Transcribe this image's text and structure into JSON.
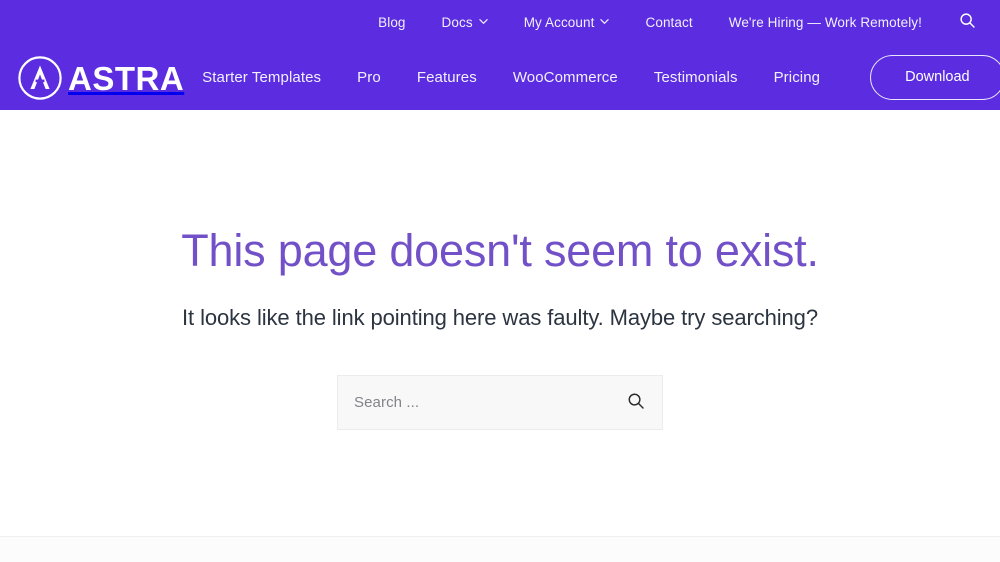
{
  "header": {
    "bg_color": "#5B2CE0",
    "brand": {
      "name": "ASTRA",
      "icon": "astra-logo-icon"
    },
    "top_nav": [
      {
        "label": "Blog",
        "has_dropdown": false
      },
      {
        "label": "Docs",
        "has_dropdown": true
      },
      {
        "label": "My Account",
        "has_dropdown": true
      },
      {
        "label": "Contact",
        "has_dropdown": false
      },
      {
        "label": "We're Hiring — Work Remotely!",
        "has_dropdown": false
      }
    ],
    "top_search_icon": "search-icon",
    "main_nav": [
      {
        "label": "Starter Templates"
      },
      {
        "label": "Pro"
      },
      {
        "label": "Features"
      },
      {
        "label": "WooCommerce"
      },
      {
        "label": "Testimonials"
      },
      {
        "label": "Pricing"
      }
    ],
    "download_label": "Download"
  },
  "main": {
    "title": "This page doesn't seem to exist.",
    "title_color": "#7251C8",
    "subtitle": "It looks like the link pointing here was faulty. Maybe try searching?",
    "subtitle_color": "#2b3440",
    "search": {
      "placeholder": "Search ...",
      "value": "",
      "submit_icon": "search-icon"
    }
  }
}
